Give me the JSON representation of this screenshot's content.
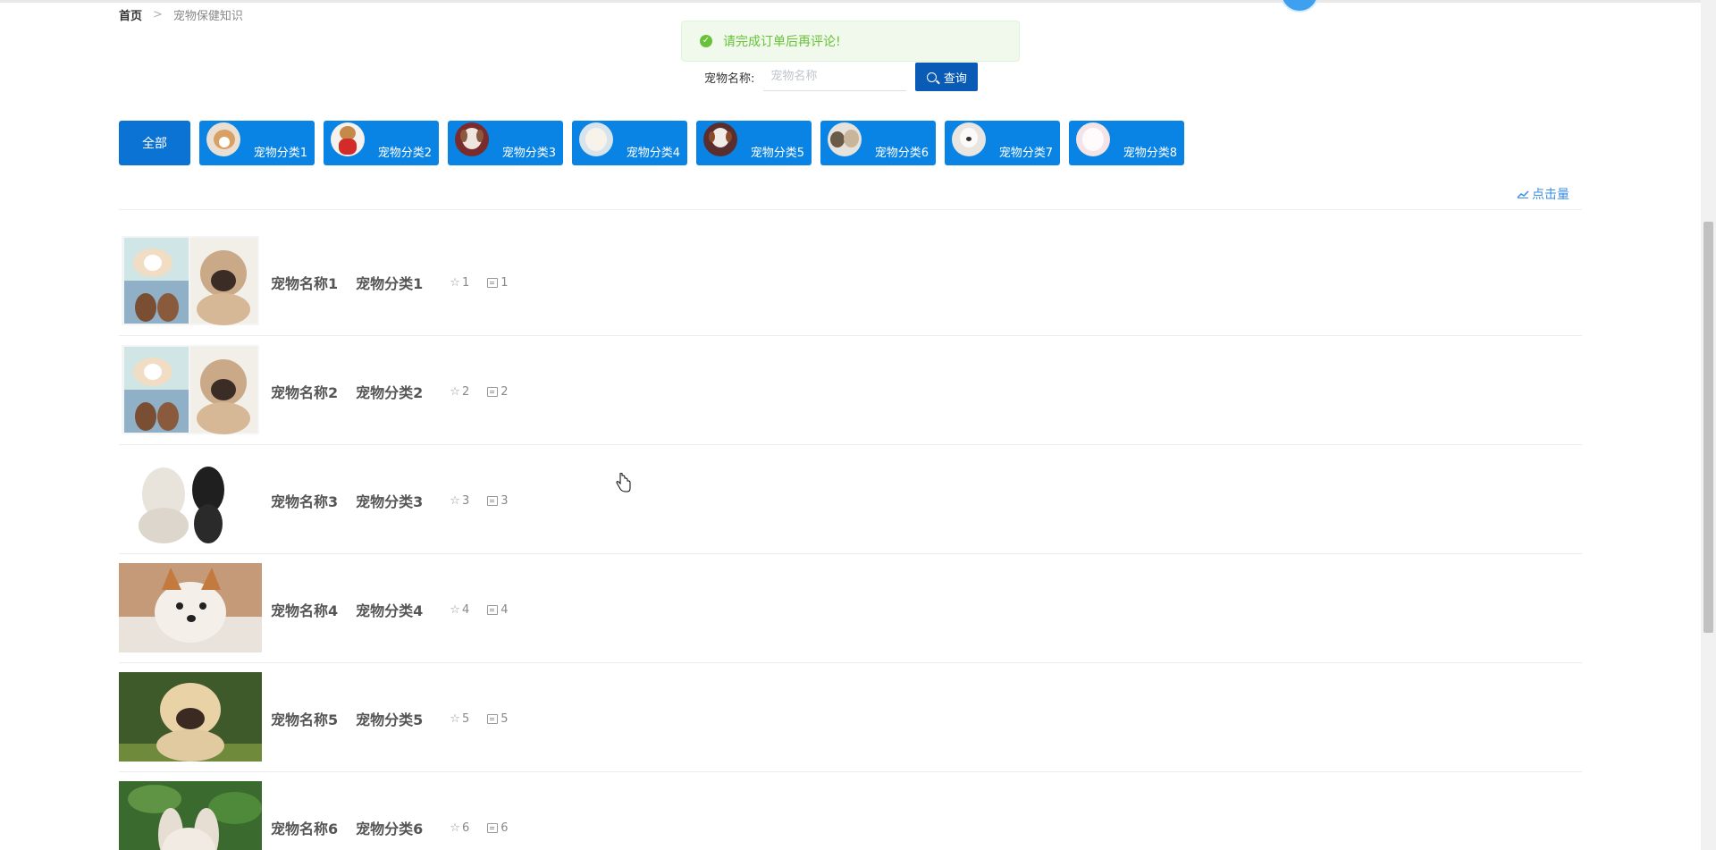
{
  "breadcrumb": {
    "home": "首页",
    "separator": ">",
    "current": "宠物保健知识"
  },
  "toast": {
    "message": "请完成订单后再评论!",
    "icon": "check-circle-icon",
    "color": "#67c23a"
  },
  "search": {
    "label": "宠物名称:",
    "placeholder": "宠物名称",
    "value": "",
    "button_label": "查询",
    "button_icon": "search-icon"
  },
  "categories": {
    "all_label": "全部",
    "items": [
      {
        "label": "宠物分类1"
      },
      {
        "label": "宠物分类2"
      },
      {
        "label": "宠物分类3"
      },
      {
        "label": "宠物分类4"
      },
      {
        "label": "宠物分类5"
      },
      {
        "label": "宠物分类6"
      },
      {
        "label": "宠物分类7"
      },
      {
        "label": "宠物分类8"
      }
    ]
  },
  "sort": {
    "label": "点击量",
    "icon": "trend-chart-icon"
  },
  "list": {
    "items": [
      {
        "name": "宠物名称1",
        "category": "宠物分类1",
        "favorites": "1",
        "comments": "1"
      },
      {
        "name": "宠物名称2",
        "category": "宠物分类2",
        "favorites": "2",
        "comments": "2"
      },
      {
        "name": "宠物名称3",
        "category": "宠物分类3",
        "favorites": "3",
        "comments": "3"
      },
      {
        "name": "宠物名称4",
        "category": "宠物分类4",
        "favorites": "4",
        "comments": "4"
      },
      {
        "name": "宠物名称5",
        "category": "宠物分类5",
        "favorites": "5",
        "comments": "5"
      },
      {
        "name": "宠物名称6",
        "category": "宠物分类6",
        "favorites": "6",
        "comments": "6"
      }
    ]
  },
  "colors": {
    "primary_button": "#0a84e4",
    "all_button": "#0a73d3",
    "search_button": "#0a5bb5",
    "link": "#3a8ee6"
  }
}
